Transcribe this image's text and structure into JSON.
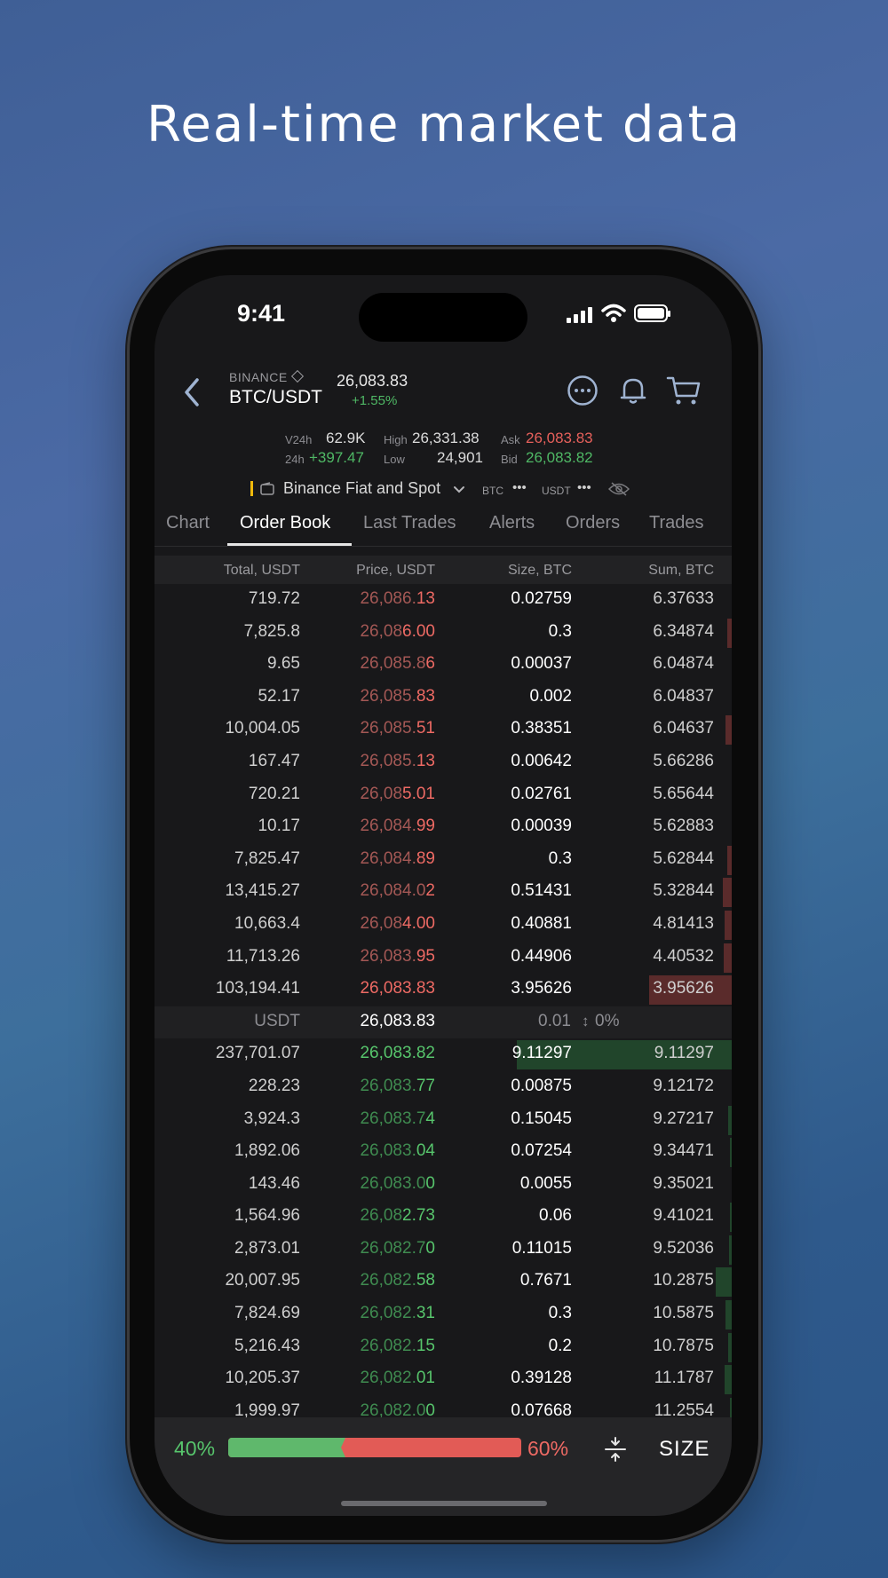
{
  "headline": "Real-time market data",
  "status": {
    "time": "9:41"
  },
  "header": {
    "exchange": "BINANCE",
    "pair": "BTC/USDT",
    "price": "26,083.83",
    "change": "+1.55%"
  },
  "stats": {
    "v24h_label": "V24h",
    "v24h": "62.9K",
    "h24_label": "24h",
    "h24": "+397.47",
    "high_label": "High",
    "high": "26,331.38",
    "low_label": "Low",
    "low": "24,901",
    "ask_label": "Ask",
    "ask": "26,083.83",
    "bid_label": "Bid",
    "bid": "26,083.82"
  },
  "market": {
    "name": "Binance Fiat and Spot",
    "btc": "BTC",
    "usdt": "USDT",
    "dots": "•••"
  },
  "tabs": [
    "Chart",
    "Order Book",
    "Last Trades",
    "Alerts",
    "Orders",
    "Trades"
  ],
  "columns": {
    "total": "Total, USDT",
    "price": "Price, USDT",
    "size": "Size, BTC",
    "sum": "Sum, BTC"
  },
  "asks": [
    {
      "total": "719.72",
      "p_dim": "26,086.",
      "p_bright": "13",
      "size": "0.02759",
      "sum": "6.37633",
      "depth": 0
    },
    {
      "total": "7,825.8",
      "p_dim": "26,08",
      "p_bright": "6.00",
      "size": "0.3",
      "sum": "6.34874",
      "depth": 6
    },
    {
      "total": "9.65",
      "p_dim": "26,085.8",
      "p_bright": "6",
      "size": "0.00037",
      "sum": "6.04874",
      "depth": 0
    },
    {
      "total": "52.17",
      "p_dim": "26,085.",
      "p_bright": "83",
      "size": "0.002",
      "sum": "6.04837",
      "depth": 0
    },
    {
      "total": "10,004.05",
      "p_dim": "26,085.",
      "p_bright": "51",
      "size": "0.38351",
      "sum": "6.04637",
      "depth": 8
    },
    {
      "total": "167.47",
      "p_dim": "26,085.",
      "p_bright": "13",
      "size": "0.00642",
      "sum": "5.66286",
      "depth": 0
    },
    {
      "total": "720.21",
      "p_dim": "26,08",
      "p_bright": "5.01",
      "size": "0.02761",
      "sum": "5.65644",
      "depth": 0
    },
    {
      "total": "10.17",
      "p_dim": "26,084.",
      "p_bright": "99",
      "size": "0.00039",
      "sum": "5.62883",
      "depth": 0
    },
    {
      "total": "7,825.47",
      "p_dim": "26,084.",
      "p_bright": "89",
      "size": "0.3",
      "sum": "5.62844",
      "depth": 6
    },
    {
      "total": "13,415.27",
      "p_dim": "26,084.0",
      "p_bright": "2",
      "size": "0.51431",
      "sum": "5.32844",
      "depth": 11
    },
    {
      "total": "10,663.4",
      "p_dim": "26,08",
      "p_bright": "4.00",
      "size": "0.40881",
      "sum": "4.81413",
      "depth": 9
    },
    {
      "total": "11,713.26",
      "p_dim": "26,083.",
      "p_bright": "95",
      "size": "0.44906",
      "sum": "4.40532",
      "depth": 10
    },
    {
      "total": "103,194.41",
      "p_dim": "",
      "p_bright": "26,083.83",
      "size": "3.95626",
      "sum": "3.95626",
      "depth": 105
    }
  ],
  "mid": {
    "unit": "USDT",
    "price": "26,083.83",
    "spread": "0.01",
    "spread_pct": "0%"
  },
  "bids": [
    {
      "total": "237,701.07",
      "p_dim": "",
      "p_bright": "26,083.82",
      "size": "9.11297",
      "sum": "9.11297",
      "depth": 244
    },
    {
      "total": "228.23",
      "p_dim": "26,083.",
      "p_bright": "77",
      "size": "0.00875",
      "sum": "9.12172",
      "depth": 0
    },
    {
      "total": "3,924.3",
      "p_dim": "26,083.7",
      "p_bright": "4",
      "size": "0.15045",
      "sum": "9.27217",
      "depth": 4
    },
    {
      "total": "1,892.06",
      "p_dim": "26,083.",
      "p_bright": "04",
      "size": "0.07254",
      "sum": "9.34471",
      "depth": 2
    },
    {
      "total": "143.46",
      "p_dim": "26,083.0",
      "p_bright": "0",
      "size": "0.0055",
      "sum": "9.35021",
      "depth": 0
    },
    {
      "total": "1,564.96",
      "p_dim": "26,08",
      "p_bright": "2.73",
      "size": "0.06",
      "sum": "9.41021",
      "depth": 2
    },
    {
      "total": "2,873.01",
      "p_dim": "26,082.7",
      "p_bright": "0",
      "size": "0.11015",
      "sum": "9.52036",
      "depth": 3
    },
    {
      "total": "20,007.95",
      "p_dim": "26,082.",
      "p_bright": "58",
      "size": "0.7671",
      "sum": "10.2875",
      "depth": 20
    },
    {
      "total": "7,824.69",
      "p_dim": "26,082.",
      "p_bright": "31",
      "size": "0.3",
      "sum": "10.5875",
      "depth": 8
    },
    {
      "total": "5,216.43",
      "p_dim": "26,082.",
      "p_bright": "15",
      "size": "0.2",
      "sum": "10.7875",
      "depth": 5
    },
    {
      "total": "10,205.37",
      "p_dim": "26,082.",
      "p_bright": "01",
      "size": "0.39128",
      "sum": "11.1787",
      "depth": 9
    },
    {
      "total": "1,999.97",
      "p_dim": "26,082.0",
      "p_bright": "0",
      "size": "0.07668",
      "sum": "11.2554",
      "depth": 2
    }
  ],
  "footer": {
    "buy_pct": "40%",
    "sell_pct": "60%",
    "buy_ratio": 0.4,
    "size_label": "SIZE"
  },
  "colors": {
    "accent": "#f0b90b",
    "ask": "#e6605b",
    "bid": "#4fb865"
  }
}
